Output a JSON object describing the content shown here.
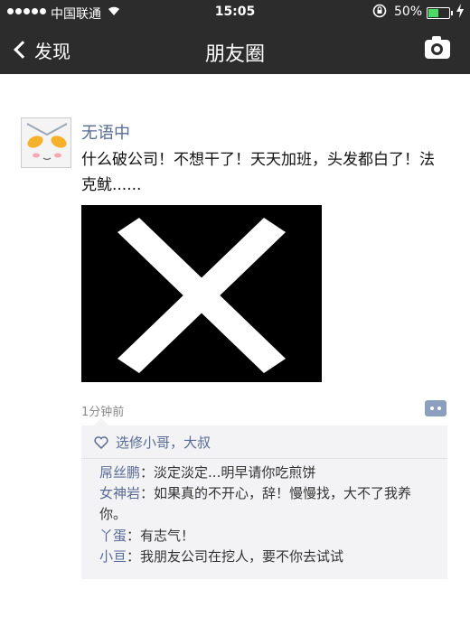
{
  "status_bar": {
    "carrier": "中国联通",
    "time": "15:05",
    "battery_percent": "50%",
    "battery_level": 0.5
  },
  "nav": {
    "back_label": "发现",
    "title": "朋友圈"
  },
  "post": {
    "author": "无语中",
    "text": "什么破公司！不想干了！天天加班，头发都白了！法克鱿......",
    "time_ago": "1分钟前",
    "likes": "选修小哥，大叔",
    "comments": [
      {
        "name": "屌丝鹏",
        "sep": "：",
        "text": "淡定淡定...明早请你吃煎饼"
      },
      {
        "name": "女神岩",
        "sep": "：",
        "text": "如果真的不开心，辞！慢慢找，大不了我养你。"
      },
      {
        "name": "丫蛋",
        "sep": "：",
        "text": "有志气！"
      },
      {
        "name": "小亘",
        "sep": "：",
        "text": "我朋友公司在挖人，要不你去试试"
      }
    ]
  },
  "colors": {
    "nav_bg": "#2c2c2c",
    "link_blue": "#576b95",
    "comment_bg": "#f3f3f5"
  },
  "icons": [
    "signal-dots-icon",
    "wifi-icon",
    "rotation-lock-icon",
    "battery-icon",
    "charging-icon",
    "back-chevron-icon",
    "camera-icon",
    "heart-icon",
    "comment-icon"
  ]
}
